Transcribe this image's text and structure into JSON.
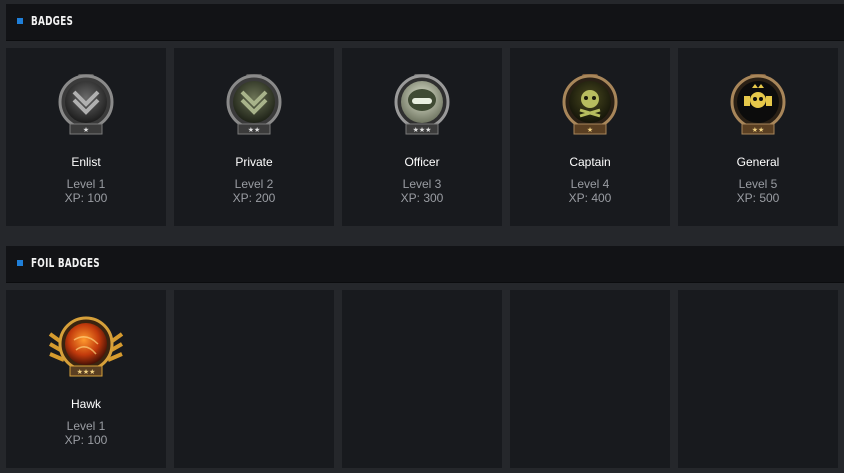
{
  "sections": [
    {
      "title": "BADGES"
    },
    {
      "title": "FOIL BADGES"
    }
  ],
  "badges": [
    {
      "name": "Enlist",
      "level": "Level 1",
      "xp": "XP: 100",
      "icon": "enlist-medal-icon",
      "stars": "★"
    },
    {
      "name": "Private",
      "level": "Level 2",
      "xp": "XP: 200",
      "icon": "private-medal-icon",
      "stars": "★★"
    },
    {
      "name": "Officer",
      "level": "Level 3",
      "xp": "XP: 300",
      "icon": "officer-medal-icon",
      "stars": "★★★"
    },
    {
      "name": "Captain",
      "level": "Level 4",
      "xp": "XP: 400",
      "icon": "captain-medal-icon",
      "stars": "★"
    },
    {
      "name": "General",
      "level": "Level 5",
      "xp": "XP: 500",
      "icon": "general-medal-icon",
      "stars": "★★"
    }
  ],
  "foil_badges": [
    {
      "name": "Hawk",
      "level": "Level 1",
      "xp": "XP: 100",
      "icon": "hawk-foil-medal-icon",
      "stars": "★★★"
    }
  ],
  "colors": {
    "accent": "#1f7fd9",
    "header_bg": "#121316",
    "card_bg": "#181a1e",
    "page_bg": "#25272b"
  }
}
